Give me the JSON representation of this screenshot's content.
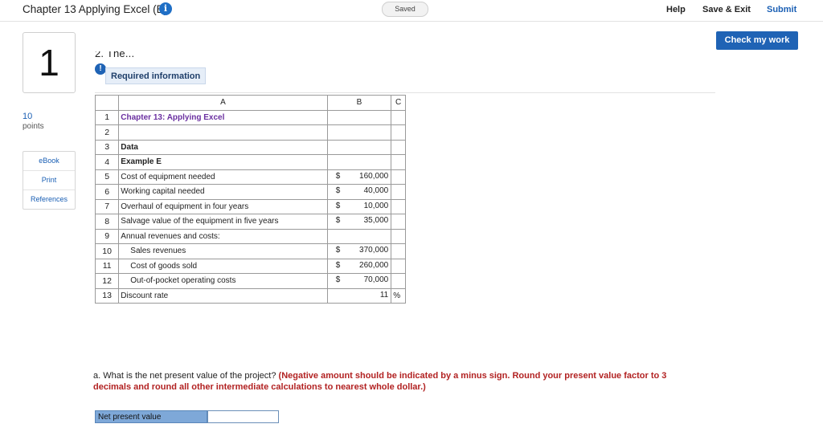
{
  "header": {
    "title": "Chapter 13 Applying Excel (B)",
    "info_icon": "i",
    "status": "Saved",
    "help_label": "Help",
    "save_exit_label": "Save & Exit",
    "submit_label": "Submit"
  },
  "check_my_work_label": "Check my work",
  "question": {
    "number": "1",
    "points_value": "10",
    "points_label": "points",
    "truncated_intro": "2. The...",
    "alert_icon": "!",
    "required_tab_label": "Required information"
  },
  "side_links": [
    {
      "label": "eBook"
    },
    {
      "label": "Print"
    },
    {
      "label": "References"
    }
  ],
  "sheet": {
    "columns": [
      "A",
      "B",
      "C"
    ],
    "rows": [
      {
        "n": "1",
        "a": "Chapter 13: Applying Excel",
        "cur": "",
        "b": "",
        "c": ""
      },
      {
        "n": "2",
        "a": "",
        "cur": "",
        "b": "",
        "c": ""
      },
      {
        "n": "3",
        "a": "Data",
        "cur": "",
        "b": "",
        "c": ""
      },
      {
        "n": "4",
        "a": "Example E",
        "cur": "",
        "b": "",
        "c": ""
      },
      {
        "n": "5",
        "a": "Cost of equipment needed",
        "cur": "$",
        "b": "160,000",
        "c": ""
      },
      {
        "n": "6",
        "a": "Working capital needed",
        "cur": "$",
        "b": "40,000",
        "c": ""
      },
      {
        "n": "7",
        "a": "Overhaul of equipment in four years",
        "cur": "$",
        "b": "10,000",
        "c": ""
      },
      {
        "n": "8",
        "a": "Salvage value of the equipment in five years",
        "cur": "$",
        "b": "35,000",
        "c": ""
      },
      {
        "n": "9",
        "a": "Annual revenues and costs:",
        "cur": "",
        "b": "",
        "c": ""
      },
      {
        "n": "10",
        "a": "Sales revenues",
        "cur": "$",
        "b": "370,000",
        "c": ""
      },
      {
        "n": "11",
        "a": "Cost of goods sold",
        "cur": "$",
        "b": "260,000",
        "c": ""
      },
      {
        "n": "12",
        "a": "Out-of-pocket operating costs",
        "cur": "$",
        "b": "70,000",
        "c": ""
      },
      {
        "n": "13",
        "a": "Discount rate",
        "cur": "",
        "b": "11",
        "c": "%"
      }
    ]
  },
  "prompt": {
    "text": "a. What is the net present value of the project? ",
    "instruction": "(Negative amount should be indicated by a minus sign. Round your present value factor to 3 decimals and round all other intermediate calculations to nearest whole dollar.)"
  },
  "answer": {
    "label": "Net present value",
    "value": "",
    "placeholder": ""
  }
}
